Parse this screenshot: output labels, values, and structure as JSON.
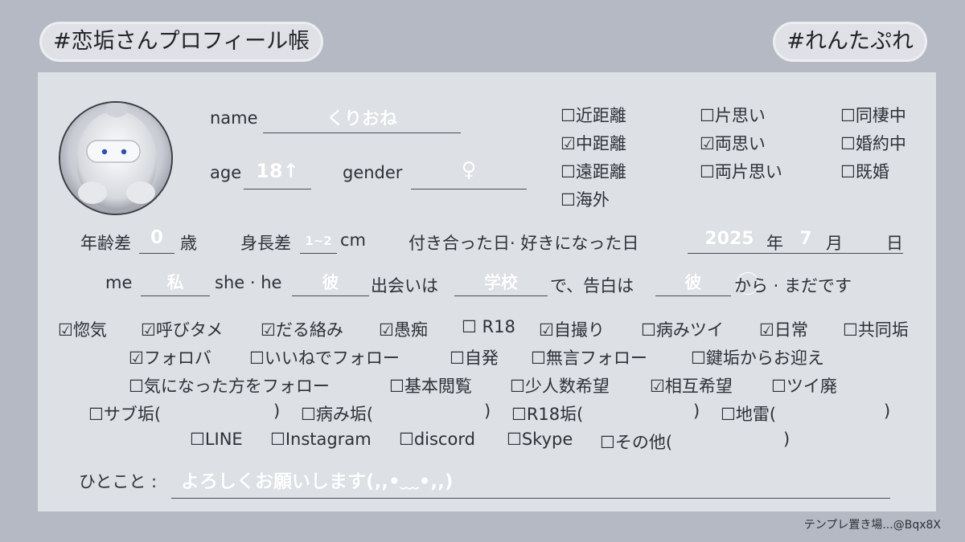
{
  "header": {
    "left_tag": "#恋垢さんプロフィール帳",
    "right_tag": "#れんたぷれ"
  },
  "profile": {
    "name_label": "name",
    "name_value": "くりおね",
    "age_label": "age",
    "age_value": "18↑",
    "gender_label": "gender",
    "gender_value": "♀"
  },
  "distance_options": [
    {
      "label": "近距離",
      "checked": false
    },
    {
      "label": "片思い",
      "checked": false
    },
    {
      "label": "同棲中",
      "checked": false
    },
    {
      "label": "中距離",
      "checked": true
    },
    {
      "label": "両思い",
      "checked": true
    },
    {
      "label": "婚約中",
      "checked": false
    },
    {
      "label": "遠距離",
      "checked": false
    },
    {
      "label": "両片思い",
      "checked": false
    },
    {
      "label": "既婚",
      "checked": false
    },
    {
      "label": "海外",
      "checked": false
    }
  ],
  "row2": {
    "age_diff_label": "年齢差",
    "age_diff_value": "0",
    "age_diff_unit": "歳",
    "height_diff_label": "身長差",
    "height_diff_value": "1~2",
    "height_diff_unit": "cm",
    "date_label": "付き合った日· 好きになった日",
    "year_value": "2025",
    "year_unit": "年",
    "month_value": "7",
    "month_unit": "月",
    "day_unit": "日"
  },
  "row3": {
    "me_label": "me",
    "me_value": "私",
    "she_he_label": "she · he",
    "she_he_value": "彼",
    "meet_label": "出会いは",
    "meet_value": "学校",
    "confess_label": "で、告白は",
    "confess_value": "彼",
    "tail": "から · まだです"
  },
  "tags_row1": [
    {
      "label": "惚気",
      "checked": true
    },
    {
      "label": "呼びタメ",
      "checked": true
    },
    {
      "label": "だる絡み",
      "checked": true
    },
    {
      "label": "愚痴",
      "checked": true
    },
    {
      "label": " R18",
      "checked": false
    },
    {
      "label": "自撮り",
      "checked": true
    },
    {
      "label": "病みツイ",
      "checked": false
    },
    {
      "label": "日常",
      "checked": true
    },
    {
      "label": "共同垢",
      "checked": false
    }
  ],
  "tags_row2": [
    {
      "label": "フォロバ",
      "checked": true
    },
    {
      "label": "いいねでフォロー",
      "checked": false
    },
    {
      "label": "自発",
      "checked": false
    },
    {
      "label": "無言フォロー",
      "checked": false
    },
    {
      "label": "鍵垢からお迎え",
      "checked": false
    }
  ],
  "tags_row3": [
    {
      "label": "気になった方をフォロー",
      "checked": false
    },
    {
      "label": "基本閲覧",
      "checked": false
    },
    {
      "label": "少人数希望",
      "checked": false
    },
    {
      "label": "相互希望",
      "checked": true
    },
    {
      "label": "ツイ廃",
      "checked": false
    }
  ],
  "tags_row4": [
    {
      "label": "サブ垢(",
      "close": ")"
    },
    {
      "label": "病み垢(",
      "close": ")"
    },
    {
      "label": "R18垢(",
      "close": ")"
    },
    {
      "label": "地雷(",
      "close": ")"
    }
  ],
  "tags_row5": [
    {
      "label": "LINE"
    },
    {
      "label": "Instagram"
    },
    {
      "label": "discord"
    },
    {
      "label": "Skype"
    },
    {
      "label": "その他(",
      "close": ")"
    }
  ],
  "comment": {
    "label": "ひとこと :",
    "value": "よろしくお願いします(,,•﹏•,,)"
  },
  "footer": "テンプレ置き場...@Bqx8X",
  "colors": {
    "background": "#b5b9c3",
    "card": "#dde0e5",
    "fill_text": "#ffffff"
  }
}
